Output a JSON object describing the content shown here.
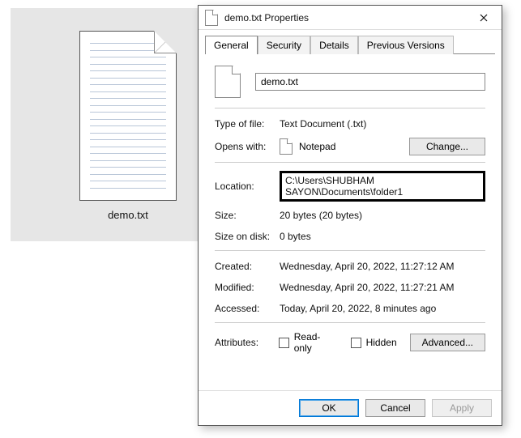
{
  "desktop": {
    "file_label": "demo.txt"
  },
  "dialog": {
    "title": "demo.txt Properties",
    "tabs": [
      "General",
      "Security",
      "Details",
      "Previous Versions"
    ],
    "active_tab": 0,
    "filename": "demo.txt",
    "rows": {
      "type_label": "Type of file:",
      "type_value": "Text Document (.txt)",
      "opens_label": "Opens with:",
      "opens_value": "Notepad",
      "change_btn": "Change...",
      "location_label": "Location:",
      "location_value": "C:\\Users\\SHUBHAM SAYON\\Documents\\folder1",
      "size_label": "Size:",
      "size_value": "20 bytes (20 bytes)",
      "sod_label": "Size on disk:",
      "sod_value": "0 bytes",
      "created_label": "Created:",
      "created_value": "Wednesday, April 20, 2022, 11:27:12 AM",
      "modified_label": "Modified:",
      "modified_value": "Wednesday, April 20, 2022, 11:27:21 AM",
      "accessed_label": "Accessed:",
      "accessed_value": "Today, April 20, 2022, 8 minutes ago",
      "attributes_label": "Attributes:",
      "readonly_label": "Read-only",
      "hidden_label": "Hidden",
      "advanced_btn": "Advanced..."
    },
    "footer": {
      "ok": "OK",
      "cancel": "Cancel",
      "apply": "Apply"
    }
  }
}
